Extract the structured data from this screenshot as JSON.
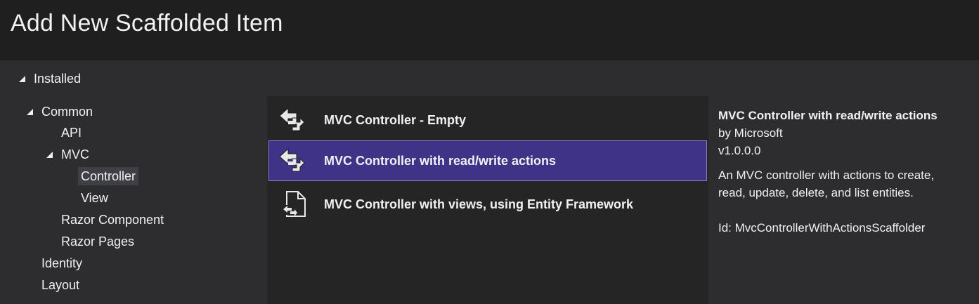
{
  "dialog": {
    "title": "Add New Scaffolded Item"
  },
  "tree": {
    "installed": "Installed",
    "common": "Common",
    "api": "API",
    "mvc": "MVC",
    "controller": "Controller",
    "view": "View",
    "razor_component": "Razor Component",
    "razor_pages": "Razor Pages",
    "identity": "Identity",
    "layout": "Layout",
    "selected": "Controller"
  },
  "items": [
    {
      "label": "MVC Controller - Empty",
      "icon": "controller-icon",
      "selected": false
    },
    {
      "label": "MVC Controller with read/write actions",
      "icon": "controller-icon",
      "selected": true
    },
    {
      "label": "MVC Controller with views, using Entity Framework",
      "icon": "document-controller-icon",
      "selected": false
    }
  ],
  "details": {
    "title": "MVC Controller with read/write actions",
    "author": "by Microsoft",
    "version": "v1.0.0.0",
    "description": "An MVC controller with actions to create, read, update, delete, and list entities.",
    "id": "Id: MvcControllerWithActionsScaffolder"
  },
  "colors": {
    "title_bar": "#1f1f1f",
    "background": "#2d2d30",
    "list_background": "#252526",
    "selection": "#3f3387",
    "selection_border": "#8b7fd6",
    "tree_selection": "#3f3f46",
    "text": "#f1f1f1"
  }
}
